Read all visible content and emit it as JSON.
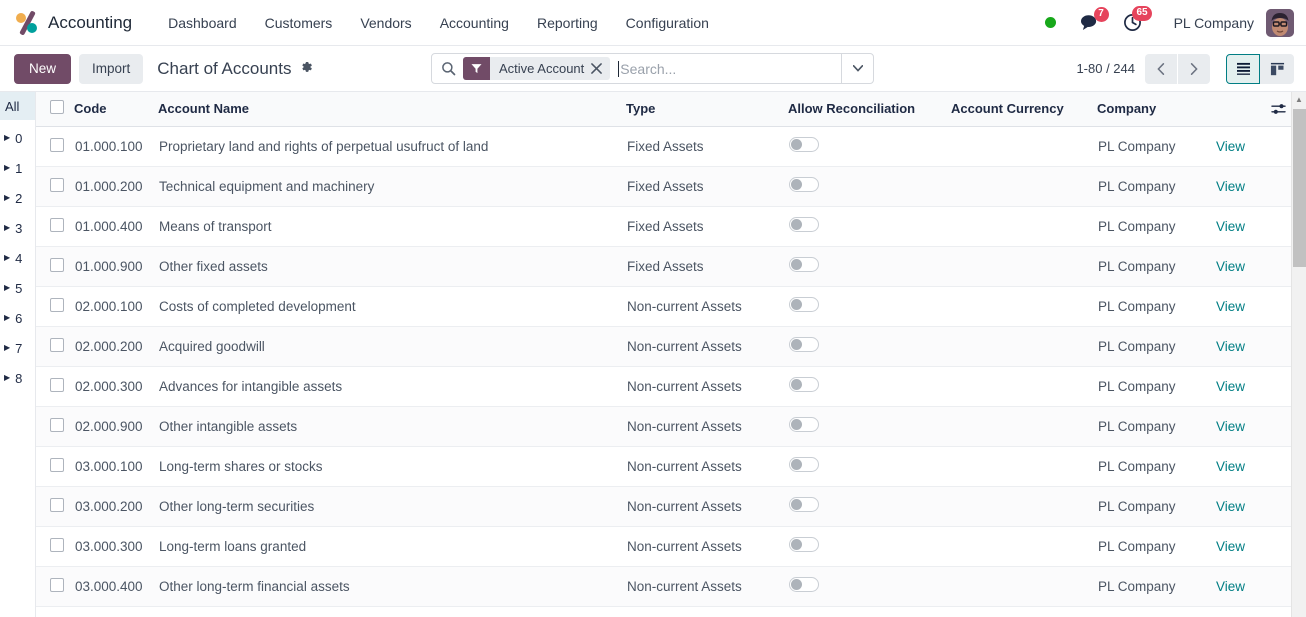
{
  "navbar": {
    "brand": "Accounting",
    "brand_logo_icon": "odoo-accounting-logo-icon",
    "menu": [
      {
        "label": "Dashboard"
      },
      {
        "label": "Customers"
      },
      {
        "label": "Vendors"
      },
      {
        "label": "Accounting"
      },
      {
        "label": "Reporting"
      },
      {
        "label": "Configuration"
      }
    ],
    "status_dot_color": "#17a81a",
    "messages_icon": "chat-bubble-icon",
    "messages_count": "7",
    "activities_icon": "clock-icon",
    "activities_count": "65",
    "company": "PL Company",
    "avatar_icon": "user-avatar"
  },
  "control_panel": {
    "new_label": "New",
    "import_label": "Import",
    "breadcrumb": "Chart of Accounts",
    "gear_icon": "gear-icon",
    "search": {
      "search_icon": "search-icon",
      "facet_icon": "filter-icon",
      "facet_label": "Active Account",
      "facet_remove_icon": "close-icon",
      "placeholder": "Search...",
      "value": "",
      "dropdown_icon": "chevron-down-icon"
    },
    "pager": "1-80 / 244",
    "prev_icon": "chevron-left-icon",
    "next_icon": "chevron-right-icon",
    "views": [
      {
        "name": "list",
        "icon": "list-view-icon",
        "active": true
      },
      {
        "name": "kanban",
        "icon": "kanban-view-icon",
        "active": false
      }
    ]
  },
  "sidebar": {
    "all_label": "All",
    "groups": [
      "0",
      "1",
      "2",
      "3",
      "4",
      "5",
      "6",
      "7",
      "8"
    ]
  },
  "table": {
    "columns": [
      "Code",
      "Account Name",
      "Type",
      "Allow Reconciliation",
      "Account Currency",
      "Company"
    ],
    "optional_columns_icon": "sliders-icon",
    "view_label": "View",
    "rows": [
      {
        "code": "01.000.100",
        "name": "Proprietary land and rights of perpetual usufruct of land",
        "type": "Fixed Assets",
        "reconciliation": false,
        "currency": "",
        "company": "PL Company"
      },
      {
        "code": "01.000.200",
        "name": "Technical equipment and machinery",
        "type": "Fixed Assets",
        "reconciliation": false,
        "currency": "",
        "company": "PL Company"
      },
      {
        "code": "01.000.400",
        "name": "Means of transport",
        "type": "Fixed Assets",
        "reconciliation": false,
        "currency": "",
        "company": "PL Company"
      },
      {
        "code": "01.000.900",
        "name": "Other fixed assets",
        "type": "Fixed Assets",
        "reconciliation": false,
        "currency": "",
        "company": "PL Company"
      },
      {
        "code": "02.000.100",
        "name": "Costs of completed development",
        "type": "Non-current Assets",
        "reconciliation": false,
        "currency": "",
        "company": "PL Company"
      },
      {
        "code": "02.000.200",
        "name": "Acquired goodwill",
        "type": "Non-current Assets",
        "reconciliation": false,
        "currency": "",
        "company": "PL Company"
      },
      {
        "code": "02.000.300",
        "name": "Advances for intangible assets",
        "type": "Non-current Assets",
        "reconciliation": false,
        "currency": "",
        "company": "PL Company"
      },
      {
        "code": "02.000.900",
        "name": "Other intangible assets",
        "type": "Non-current Assets",
        "reconciliation": false,
        "currency": "",
        "company": "PL Company"
      },
      {
        "code": "03.000.100",
        "name": "Long-term shares or stocks",
        "type": "Non-current Assets",
        "reconciliation": false,
        "currency": "",
        "company": "PL Company"
      },
      {
        "code": "03.000.200",
        "name": "Other long-term securities",
        "type": "Non-current Assets",
        "reconciliation": false,
        "currency": "",
        "company": "PL Company"
      },
      {
        "code": "03.000.300",
        "name": "Long-term loans granted",
        "type": "Non-current Assets",
        "reconciliation": false,
        "currency": "",
        "company": "PL Company"
      },
      {
        "code": "03.000.400",
        "name": "Other long-term financial assets",
        "type": "Non-current Assets",
        "reconciliation": false,
        "currency": "",
        "company": "PL Company"
      }
    ]
  },
  "colors": {
    "brand_purple": "#714b67",
    "accent_teal": "#017e84",
    "badge_red": "#e6445c",
    "status_green": "#17a81a"
  }
}
